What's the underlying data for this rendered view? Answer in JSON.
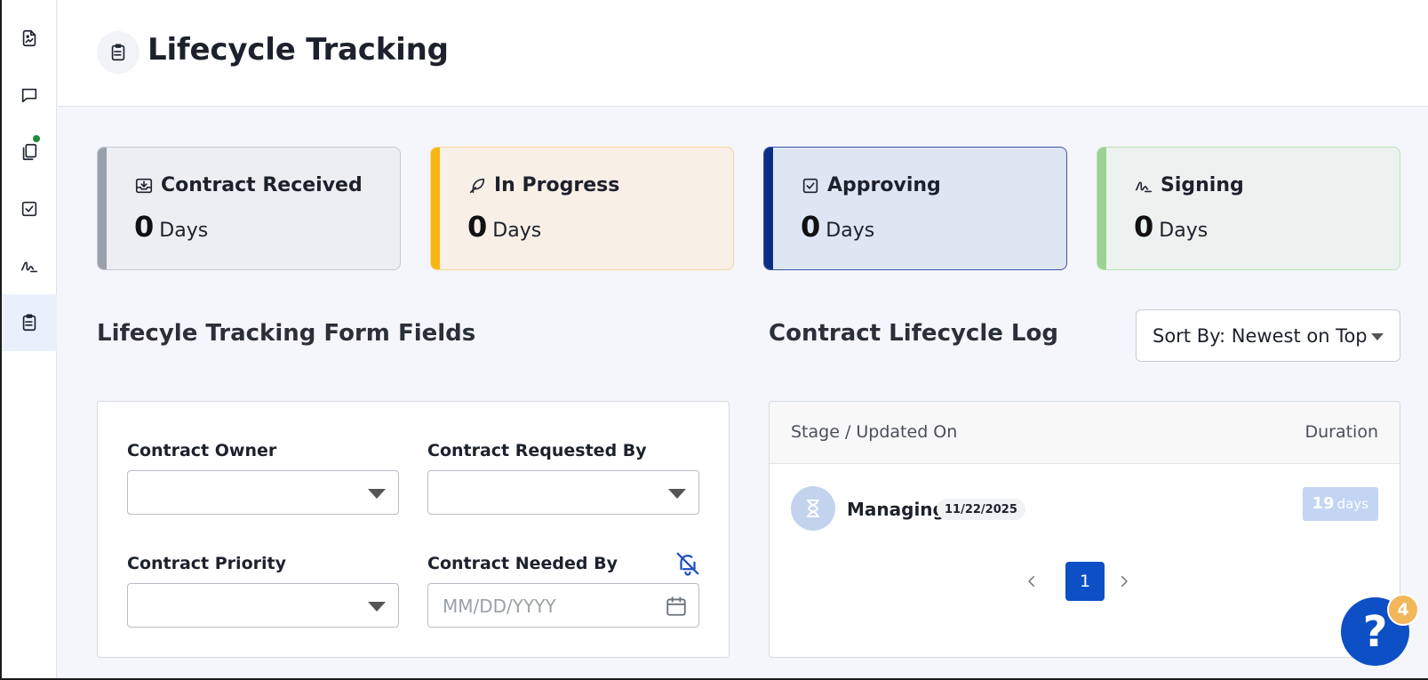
{
  "header": {
    "title": "Lifecycle Tracking",
    "icon": "clipboard-list-icon"
  },
  "sidebar": {
    "items": [
      {
        "icon": "document-image-icon"
      },
      {
        "icon": "chat-bubble-icon"
      },
      {
        "icon": "copy-documents-icon",
        "has_notification": true,
        "notification_color": "#1e8a3a"
      },
      {
        "icon": "checkbox-icon"
      },
      {
        "icon": "signature-icon"
      },
      {
        "icon": "clipboard-list-icon",
        "active": true
      }
    ]
  },
  "stages": {
    "received": {
      "title": "Contract Received",
      "value": "0",
      "unit": "Days",
      "color": "#9aa0a9"
    },
    "progress": {
      "title": "In Progress",
      "value": "0",
      "unit": "Days",
      "color": "#f7b710"
    },
    "approving": {
      "title": "Approving",
      "value": "0",
      "unit": "Days",
      "color": "#0b2f84"
    },
    "signing": {
      "title": "Signing",
      "value": "0",
      "unit": "Days",
      "color": "#9ed293"
    }
  },
  "form": {
    "section_title": "Lifecyle Tracking Form Fields",
    "owner_label": "Contract Owner",
    "requested_by_label": "Contract Requested By",
    "priority_label": "Contract Priority",
    "needed_by_label": "Contract Needed By",
    "needed_by_placeholder": "MM/DD/YYYY"
  },
  "log": {
    "section_title": "Contract Lifecycle Log",
    "sort_label": "Sort By: Newest on Top",
    "col_stage": "Stage / Updated On",
    "col_duration": "Duration",
    "rows": [
      {
        "stage": "Managing",
        "date": "11/22/2025",
        "duration": "19",
        "duration_unit": "days"
      }
    ],
    "pagination": {
      "current_page": "1"
    }
  },
  "help": {
    "label": "?",
    "badge_count": "4"
  },
  "colors": {
    "accent": "#0d4fc4"
  }
}
